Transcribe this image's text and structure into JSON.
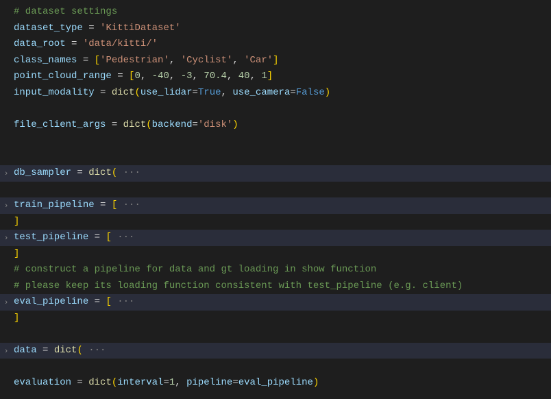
{
  "l1": {
    "comment": "# dataset settings"
  },
  "l2": {
    "var": "dataset_type",
    "op": " = ",
    "str": "'KittiDataset'"
  },
  "l3": {
    "var": "data_root",
    "op": " = ",
    "str": "'data/kitti/'"
  },
  "l4": {
    "var": "class_names",
    "op": " = ",
    "br_open": "[",
    "s1": "'Pedestrian'",
    "c1": ", ",
    "s2": "'Cyclist'",
    "c2": ", ",
    "s3": "'Car'",
    "br_close": "]"
  },
  "l5": {
    "var": "point_cloud_range",
    "op": " = ",
    "br_open": "[",
    "n1": "0",
    "c1": ", ",
    "n2": "-40",
    "c2": ", ",
    "n3": "-3",
    "c3": ", ",
    "n4": "70.4",
    "c4": ", ",
    "n5": "40",
    "c5": ", ",
    "n6": "1",
    "br_close": "]"
  },
  "l6": {
    "var": "input_modality",
    "op": " = ",
    "fn": "dict",
    "paren_o": "(",
    "p1": "use_lidar",
    "eq1": "=",
    "v1": "True",
    "c1": ", ",
    "p2": "use_camera",
    "eq2": "=",
    "v2": "False",
    "paren_c": ")"
  },
  "l8": {
    "var": "file_client_args",
    "op": " = ",
    "fn": "dict",
    "paren_o": "(",
    "p1": "backend",
    "eq1": "=",
    "s1": "'disk'",
    "paren_c": ")"
  },
  "l11": {
    "var": "db_sampler",
    "op": " = ",
    "fn": "dict",
    "paren_o": "(",
    "fold": " ···"
  },
  "l13": {
    "var": "train_pipeline",
    "op": " = ",
    "br_open": "[",
    "fold": " ···"
  },
  "l14": {
    "br_close": "]"
  },
  "l15": {
    "var": "test_pipeline",
    "op": " = ",
    "br_open": "[",
    "fold": " ···"
  },
  "l16": {
    "br_close": "]"
  },
  "l17": {
    "comment": "# construct a pipeline for data and gt loading in show function"
  },
  "l18": {
    "comment": "# please keep its loading function consistent with test_pipeline (e.g. client)"
  },
  "l19": {
    "var": "eval_pipeline",
    "op": " = ",
    "br_open": "[",
    "fold": " ···"
  },
  "l20": {
    "br_close": "]"
  },
  "l22": {
    "var": "data",
    "op": " = ",
    "fn": "dict",
    "paren_o": "(",
    "fold": " ···"
  },
  "l24": {
    "var": "evaluation",
    "op": " = ",
    "fn": "dict",
    "paren_o": "(",
    "p1": "interval",
    "eq1": "=",
    "n1": "1",
    "c1": ", ",
    "p2": "pipeline",
    "eq2": "=",
    "v2": "eval_pipeline",
    "paren_c": ")"
  },
  "chevron": "›"
}
